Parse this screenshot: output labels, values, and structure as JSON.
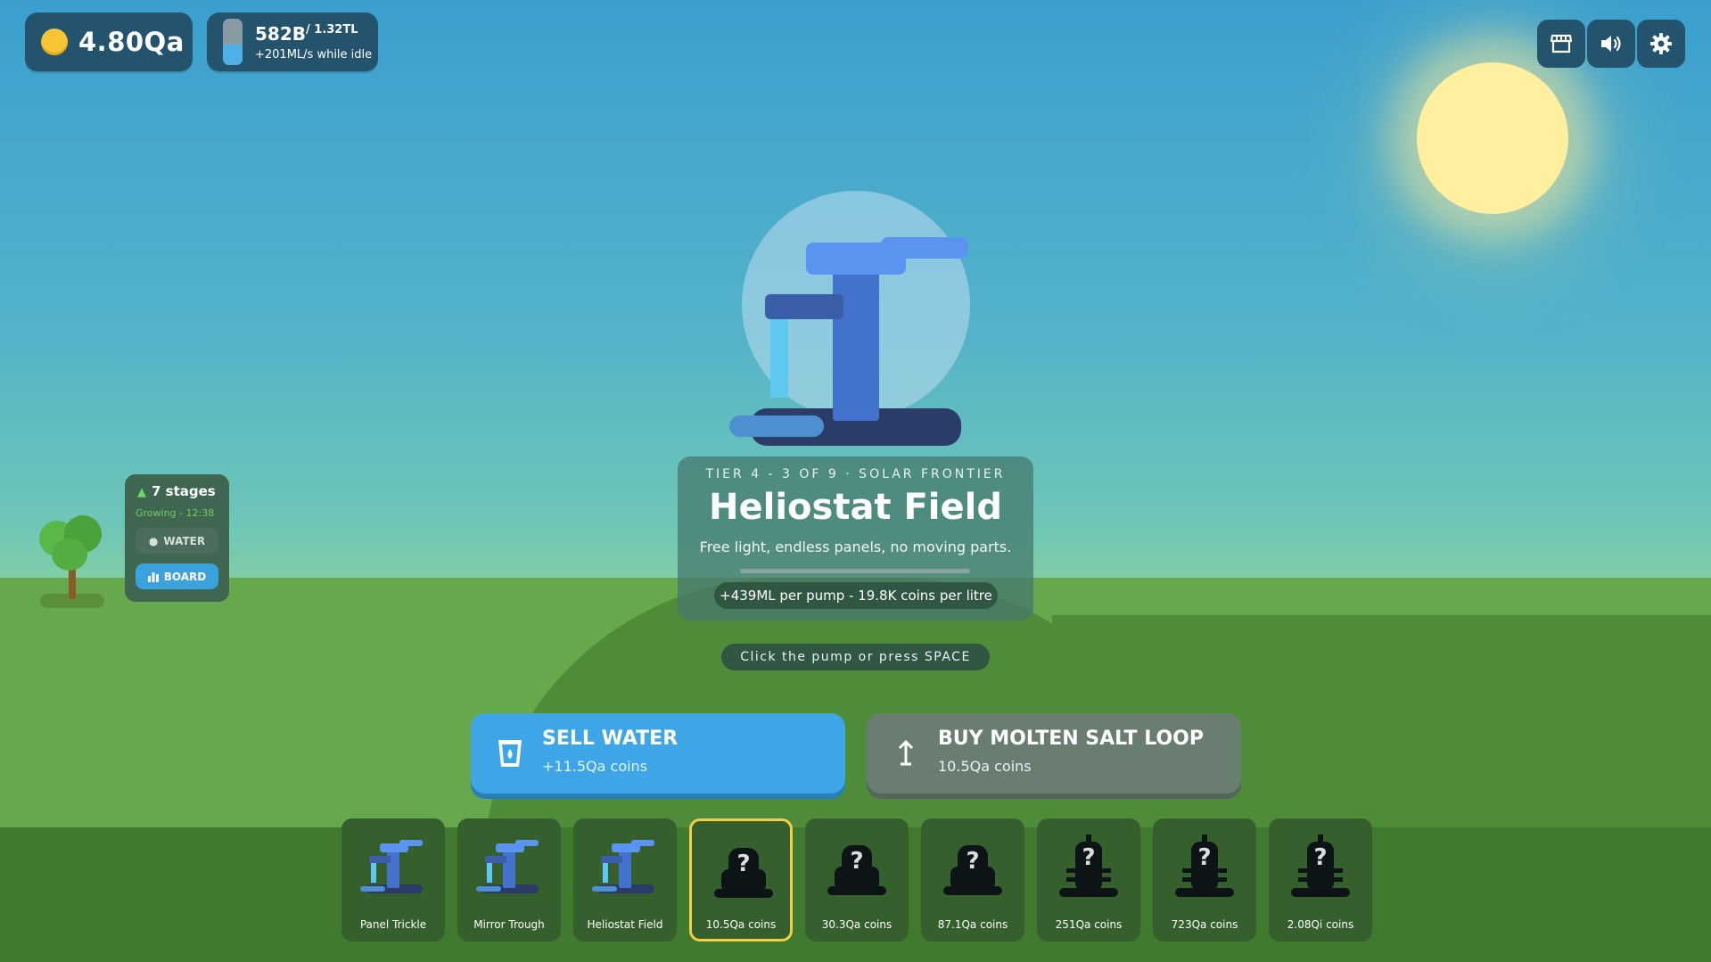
{
  "hud": {
    "coins": "4.80Qa",
    "water_amount": "582B",
    "water_capacity": "/ 1.32TL",
    "water_idle": "+201ML/s while idle",
    "tank_fill_fraction": 0.45
  },
  "topbar": {
    "icons": [
      "shop-icon",
      "speaker-icon",
      "gear-icon"
    ]
  },
  "tree": {
    "stages": "7 stages",
    "growing": "Growing - 12:38",
    "water_label": "WATER",
    "board_label": "BOARD"
  },
  "pump": {
    "tier": "TIER 4 - 3 OF 9 · SOLAR FRONTIER",
    "name": "Heliostat Field",
    "description": "Free light, endless panels, no moving parts.",
    "rate": "+439ML per pump - 19.8K coins per litre",
    "hint": "Click the pump or press SPACE"
  },
  "actions": {
    "sell_title": "SELL WATER",
    "sell_sub": "+11.5Qa coins",
    "buy_title": "BUY MOLTEN SALT LOOP",
    "buy_sub": "10.5Qa coins"
  },
  "slots": [
    {
      "label": "Panel Trickle",
      "unlocked": true
    },
    {
      "label": "Mirror Trough",
      "unlocked": true
    },
    {
      "label": "Heliostat Field",
      "unlocked": true
    },
    {
      "label": "10.5Qa coins",
      "unlocked": false,
      "selected": true
    },
    {
      "label": "30.3Qa coins",
      "unlocked": false
    },
    {
      "label": "87.1Qa coins",
      "unlocked": false
    },
    {
      "label": "251Qa coins",
      "unlocked": false
    },
    {
      "label": "723Qa coins",
      "unlocked": false
    },
    {
      "label": "2.08Qi coins",
      "unlocked": false
    }
  ],
  "colors": {
    "accent": "#3ea6e6",
    "hud_bg": "#24536d",
    "selected_outline": "#f2cf45",
    "coin": "#f6c533"
  }
}
